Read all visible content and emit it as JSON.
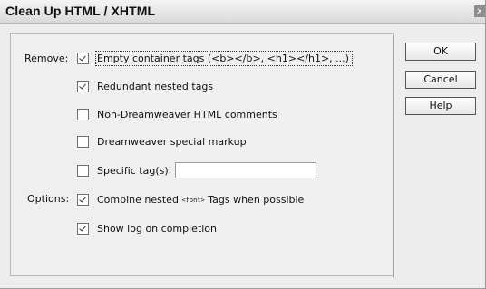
{
  "dialog": {
    "title": "Clean Up HTML / XHTML",
    "close_glyph": "x"
  },
  "labels": {
    "remove": "Remove:",
    "options": "Options:"
  },
  "remove_items": [
    {
      "label": "Empty container tags (<b></b>, <h1></h1>, ...)",
      "checked": true
    },
    {
      "label": "Redundant nested tags",
      "checked": true
    },
    {
      "label": "Non-Dreamweaver HTML comments",
      "checked": false
    },
    {
      "label": "Dreamweaver special markup",
      "checked": false
    },
    {
      "label": "Specific tag(s):",
      "checked": false
    }
  ],
  "specific_tags_input": {
    "value": ""
  },
  "options_items": [
    {
      "label_pre": "Combine nested ",
      "label_code": "<font>",
      "label_post": " Tags when possible",
      "checked": true
    },
    {
      "label": "Show log on completion",
      "checked": true
    }
  ],
  "buttons": {
    "ok": "OK",
    "cancel": "Cancel",
    "help": "Help"
  }
}
